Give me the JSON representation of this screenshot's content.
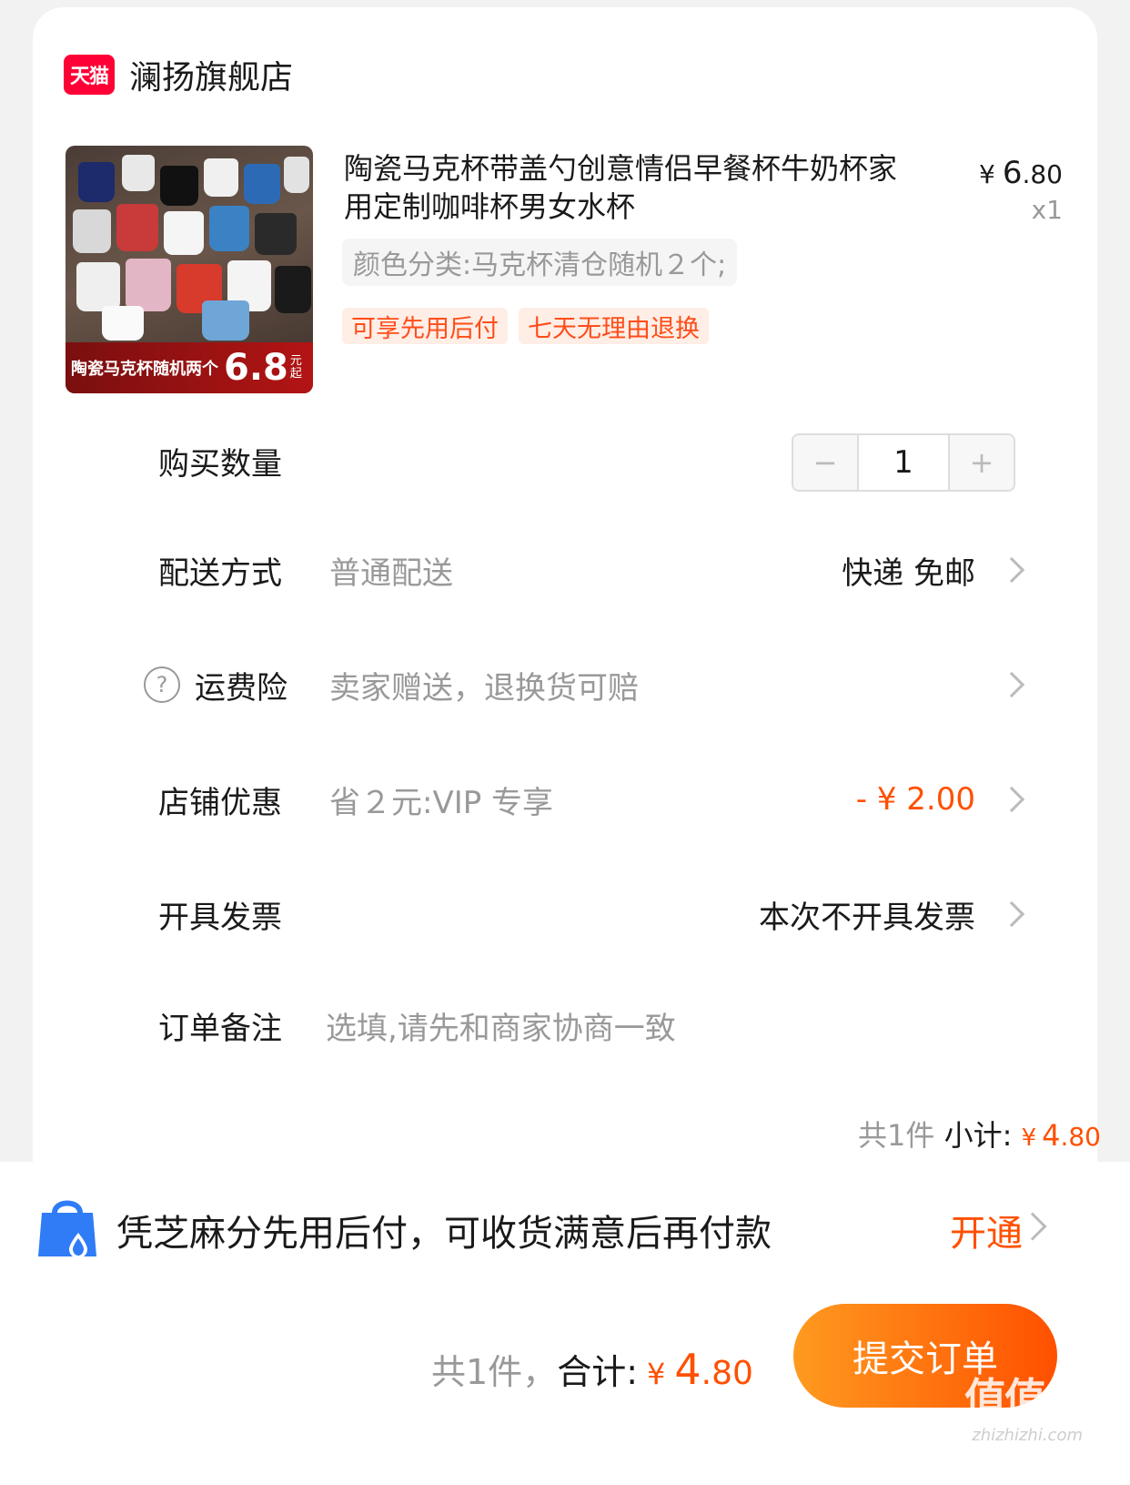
{
  "shop": {
    "logo_text": "天猫",
    "name": "澜扬旗舰店"
  },
  "product": {
    "title": "陶瓷马克杯带盖勺创意情侣早餐杯牛奶杯家用定制咖啡杯男女水杯",
    "price_currency": "¥",
    "price_int": "6",
    "price_dec": ".80",
    "quantity": "x1",
    "sku": "颜色分类:马克杯清仓随机２个;",
    "tags": [
      "可享先用后付",
      "七天无理由退换"
    ],
    "image_banner": {
      "text": "陶瓷马克杯随机两个",
      "price": "6.8",
      "unit": "元起"
    }
  },
  "rows": {
    "quantity": {
      "label": "购买数量",
      "value": "1",
      "minus": "−",
      "plus": "+"
    },
    "delivery": {
      "label": "配送方式",
      "sub": "普通配送",
      "value": "快递 免邮"
    },
    "insurance": {
      "label": "运费险",
      "sub": "卖家赠送，退换货可赔",
      "icon": "?"
    },
    "discount": {
      "label": "店铺优惠",
      "sub": "省２元:VIP 专享",
      "value": "- ¥ 2.00"
    },
    "invoice": {
      "label": "开具发票",
      "value": "本次不开具发票"
    },
    "remark": {
      "label": "订单备注",
      "placeholder": "选填,请先和商家协商一致"
    }
  },
  "subtotal": {
    "count": "共1件",
    "label": "小计:",
    "currency": "¥",
    "int": "4",
    "dec": ".80"
  },
  "huabei": {
    "text": "凭芝麻分先用后付，可收货满意后再付款",
    "action": "开通"
  },
  "footer": {
    "count": "共1件，",
    "label": "合计:",
    "currency": "¥",
    "int": "4",
    "dec": ".80",
    "submit": "提交订单"
  },
  "watermark": {
    "text": "值值值",
    "url": "zhizhizhi.com"
  },
  "colors": {
    "accent": "#ff5000",
    "tmall": "#ff0036",
    "muted": "#999999"
  }
}
